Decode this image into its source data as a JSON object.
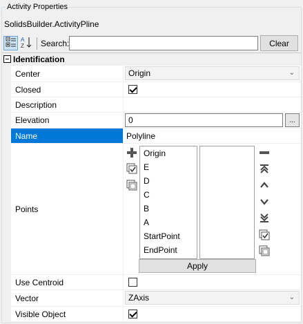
{
  "group": {
    "title": "Activity Properties"
  },
  "object_name": "SolidsBuilder.ActivityPline",
  "toolbar": {
    "categorized_icon": "categorized-icon",
    "alphabetical_icon": "alphabetical-sort-icon",
    "search_label": "Search:",
    "search_value": "",
    "clear_label": "Clear"
  },
  "grid": {
    "category": {
      "label": "Identification",
      "toggle": "⊟"
    },
    "rows": [
      {
        "name": "Center",
        "value": "Origin",
        "kind": "combo"
      },
      {
        "name": "Closed",
        "checked": true,
        "kind": "checkbox"
      },
      {
        "name": "Description",
        "value": "",
        "kind": "text"
      },
      {
        "name": "Elevation",
        "value": "0",
        "kind": "textbutton",
        "button": "..."
      },
      {
        "name": "Name",
        "value": "Polyline",
        "kind": "text",
        "selected": true
      },
      {
        "name": "Points",
        "kind": "points"
      },
      {
        "name": "Use Centroid",
        "checked": false,
        "kind": "checkbox"
      },
      {
        "name": "Vector",
        "value": "ZAxis",
        "kind": "combo"
      },
      {
        "name": "Visible Object",
        "checked": true,
        "kind": "checkbox"
      }
    ],
    "points": {
      "available": [
        "Origin",
        "E",
        "D",
        "C",
        "B",
        "A",
        "StartPoint",
        "EndPoint"
      ],
      "selected": [],
      "apply_label": "Apply",
      "left_icons": [
        "add-icon",
        "check-all-icon",
        "uncheck-all-icon"
      ],
      "right_icons": [
        "remove-icon",
        "move-top-icon",
        "move-up-icon",
        "move-down-icon",
        "move-bottom-icon",
        "check-all-icon",
        "uncheck-all-icon"
      ]
    }
  },
  "colors": {
    "selection": "#0078d7",
    "gutter": "#f0f0f0",
    "accent_icon": "#555555"
  }
}
